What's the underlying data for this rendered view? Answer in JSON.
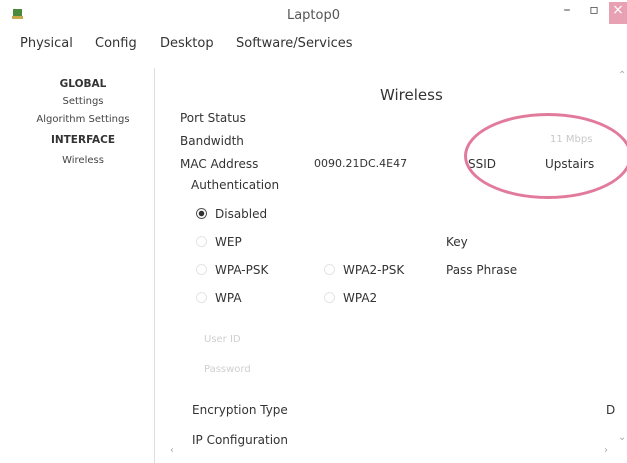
{
  "window": {
    "title": "Laptop0",
    "min_glyph": "–",
    "max_glyph": "▫",
    "close_glyph": "×"
  },
  "tabs": [
    {
      "label": "Physical"
    },
    {
      "label": "Config"
    },
    {
      "label": "Desktop"
    },
    {
      "label": "Software/Services"
    }
  ],
  "sidebar": {
    "items": [
      {
        "label": "GLOBAL",
        "header": true
      },
      {
        "label": "Settings"
      },
      {
        "label": "Algorithm Settings"
      },
      {
        "label": "INTERFACE",
        "header": true
      },
      {
        "label": "Wireless"
      }
    ]
  },
  "panel": {
    "title": "Wireless",
    "port_status_label": "Port Status",
    "bandwidth_label": "Bandwidth",
    "bandwidth_value": "11 Mbps",
    "mac_label": "MAC Address",
    "mac_value": "0090.21DC.4E47",
    "ssid_label": "SSID",
    "ssid_value": "Upstairs",
    "auth_label": "Authentication",
    "auth_options": [
      {
        "label": "Disabled",
        "selected": true
      },
      {
        "label": "WEP"
      },
      {
        "label": "WPA-PSK"
      },
      {
        "label": "WPA2-PSK"
      },
      {
        "label": "WPA"
      },
      {
        "label": "WPA2"
      }
    ],
    "key_label": "Key",
    "passphrase_label": "Pass Phrase",
    "user_id_label": "User ID",
    "password_label": "Password",
    "encryption_label": "Encryption Type",
    "encryption_value": "D",
    "ip_config_label": "IP Configuration"
  },
  "colors": {
    "highlight": "#e27a9c",
    "close_button": "#e8a1b2"
  }
}
